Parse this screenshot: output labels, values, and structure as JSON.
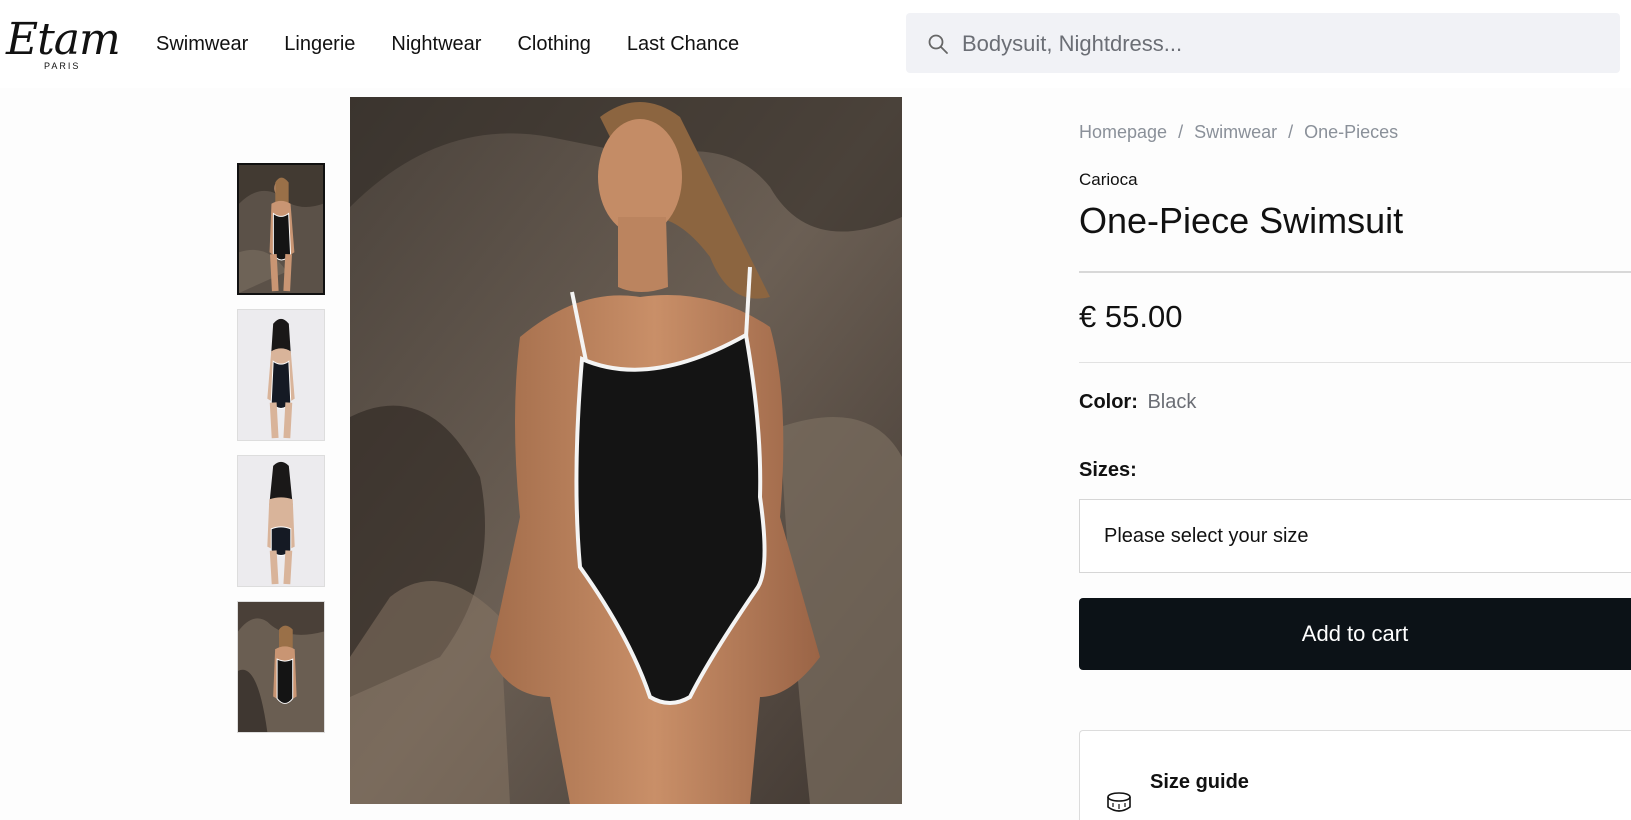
{
  "header": {
    "logo": {
      "word": "Etam",
      "sub": "PARIS"
    },
    "nav": [
      "Swimwear",
      "Lingerie",
      "Nightwear",
      "Clothing",
      "Last Chance"
    ],
    "search": {
      "placeholder": "Bodysuit, Nightdress...",
      "icon": "search-icon"
    }
  },
  "gallery": {
    "thumbnails": [
      {
        "name": "thumbnail-1",
        "scene": "rocks",
        "active": true
      },
      {
        "name": "thumbnail-2",
        "scene": "studio-front",
        "active": false
      },
      {
        "name": "thumbnail-3",
        "scene": "studio-back",
        "active": false
      },
      {
        "name": "thumbnail-4",
        "scene": "rocks-wide",
        "active": false
      }
    ]
  },
  "product": {
    "breadcrumb": [
      "Homepage",
      "Swimwear",
      "One-Pieces"
    ],
    "breadcrumb_separator": "/",
    "brand": "Carioca",
    "title": "One-Piece Swimsuit",
    "price": "€ 55.00",
    "color_label": "Color:",
    "color_value": "Black",
    "sizes_label": "Sizes:",
    "size_placeholder": "Please select your size",
    "add_to_cart": "Add to cart",
    "size_guide_label": "Size guide",
    "size_guide_icon": "measuring-tape-icon"
  },
  "colors": {
    "accent": "#0c1217",
    "muted_text": "#8a9099",
    "search_bg": "#f1f2f6"
  }
}
